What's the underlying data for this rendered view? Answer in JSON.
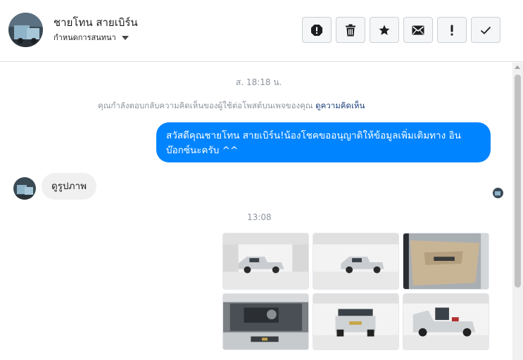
{
  "header": {
    "contact_name": "ชายโทน สายเบิร์น",
    "subtitle": "กำหนดการสนทนา",
    "actions": [
      {
        "name": "report-icon",
        "label": "report"
      },
      {
        "name": "trash-icon",
        "label": "delete"
      },
      {
        "name": "star-icon",
        "label": "star"
      },
      {
        "name": "envelope-icon",
        "label": "mark unread"
      },
      {
        "name": "exclamation-icon",
        "label": "spam"
      },
      {
        "name": "check-icon",
        "label": "done"
      }
    ]
  },
  "thread": {
    "timestamp_1": "ส. 18:18 น.",
    "notice_text": "คุณกำลังตอบกลับความคิดเห็นของผู้ใช้ต่อโพสต์บนเพจของคุณ",
    "notice_link": "ดูความคิดเห็น",
    "outgoing_message": "สวัสดีคุณชายโทน สายเบิร์น!น้องโชคขออนุญาติให้ข้อมูลเพิ่มเติมทาง อินบ๊อกซ์นะครับ ^^",
    "incoming_message": "ดูรูปภาพ",
    "timestamp_2": "13:08"
  },
  "colors": {
    "outgoing_bubble": "#0084ff",
    "incoming_bubble": "#f1f0f0",
    "timestamp": "#8d949e",
    "link": "#1c3f7a"
  }
}
